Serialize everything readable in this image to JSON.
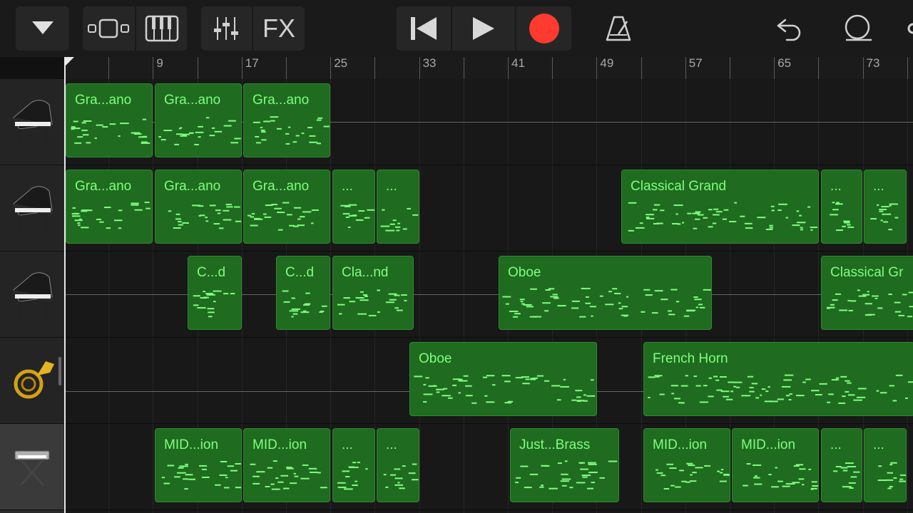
{
  "toolbar": {
    "fx_label": "FX"
  },
  "ruler": {
    "labels": [
      "9",
      "17",
      "25",
      "33",
      "41",
      "49",
      "57",
      "65",
      "73"
    ]
  },
  "tracks": [
    {
      "instrument": "grand-piano",
      "regions": [
        {
          "label": "Gra...ano"
        },
        {
          "label": "Gra...ano"
        },
        {
          "label": "Gra...ano"
        }
      ]
    },
    {
      "instrument": "grand-piano",
      "regions": [
        {
          "label": "Gra...ano"
        },
        {
          "label": "Gra...ano"
        },
        {
          "label": "Gra...ano"
        },
        {
          "label": "..."
        },
        {
          "label": "..."
        },
        {
          "label": "Classical Grand"
        },
        {
          "label": "..."
        },
        {
          "label": "..."
        }
      ]
    },
    {
      "instrument": "grand-piano",
      "regions": [
        {
          "label": "C...d"
        },
        {
          "label": "C...d"
        },
        {
          "label": "Cla...nd"
        },
        {
          "label": "Oboe"
        },
        {
          "label": "Classical Gr"
        }
      ]
    },
    {
      "instrument": "french-horn",
      "regions": [
        {
          "label": "Oboe"
        },
        {
          "label": "French Horn"
        }
      ]
    },
    {
      "instrument": "keyboard",
      "regions": [
        {
          "label": "MID...ion"
        },
        {
          "label": "MID...ion"
        },
        {
          "label": "..."
        },
        {
          "label": "..."
        },
        {
          "label": "Just...Brass"
        },
        {
          "label": "MID...ion"
        },
        {
          "label": "MID...ion"
        },
        {
          "label": "..."
        },
        {
          "label": "..."
        }
      ]
    }
  ],
  "colors": {
    "region_fill": "#1f6b1f",
    "region_text": "#7eff7e",
    "record": "#ff3b30"
  }
}
